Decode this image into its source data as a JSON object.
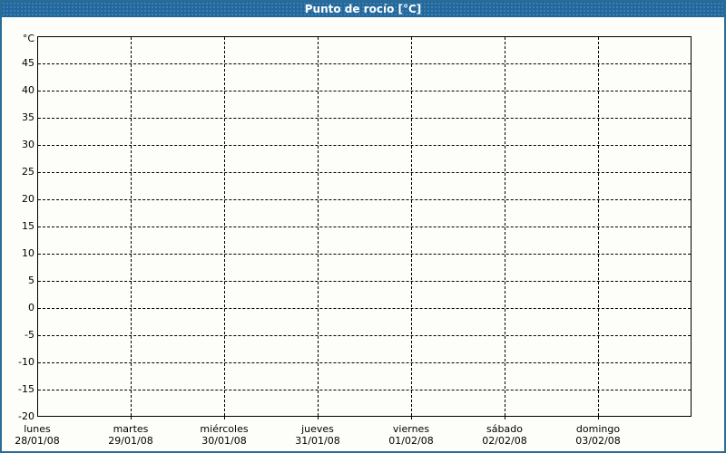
{
  "window": {
    "title": "Punto de rocío [°C]"
  },
  "colors": {
    "titlebar_bg": "#21689E",
    "titlebar_text": "#FFFFFF",
    "window_border": "#2B6B96",
    "content_bg": "#FDFEFA",
    "plot_border": "#000000",
    "gridline": "#000000",
    "label_text": "#000000"
  },
  "chart_data": {
    "type": "line",
    "title": "Punto de rocío [°C]",
    "unit_label": "°C",
    "grid": "dashed",
    "legend": "none",
    "y_axis": {
      "min": -20,
      "max": 50,
      "tick_step": 5,
      "tick_labels": [
        "45",
        "40",
        "35",
        "30",
        "25",
        "20",
        "15",
        "10",
        "5",
        "0",
        "-5",
        "-10",
        "-15",
        "-20"
      ]
    },
    "x_axis": {
      "categories": [
        {
          "day": "lunes",
          "date": "28/01/08"
        },
        {
          "day": "martes",
          "date": "29/01/08"
        },
        {
          "day": "miércoles",
          "date": "30/01/08"
        },
        {
          "day": "jueves",
          "date": "31/01/08"
        },
        {
          "day": "viernes",
          "date": "01/02/08"
        },
        {
          "day": "sábado",
          "date": "02/02/08"
        },
        {
          "day": "domingo",
          "date": "03/02/08"
        }
      ]
    },
    "series": []
  }
}
